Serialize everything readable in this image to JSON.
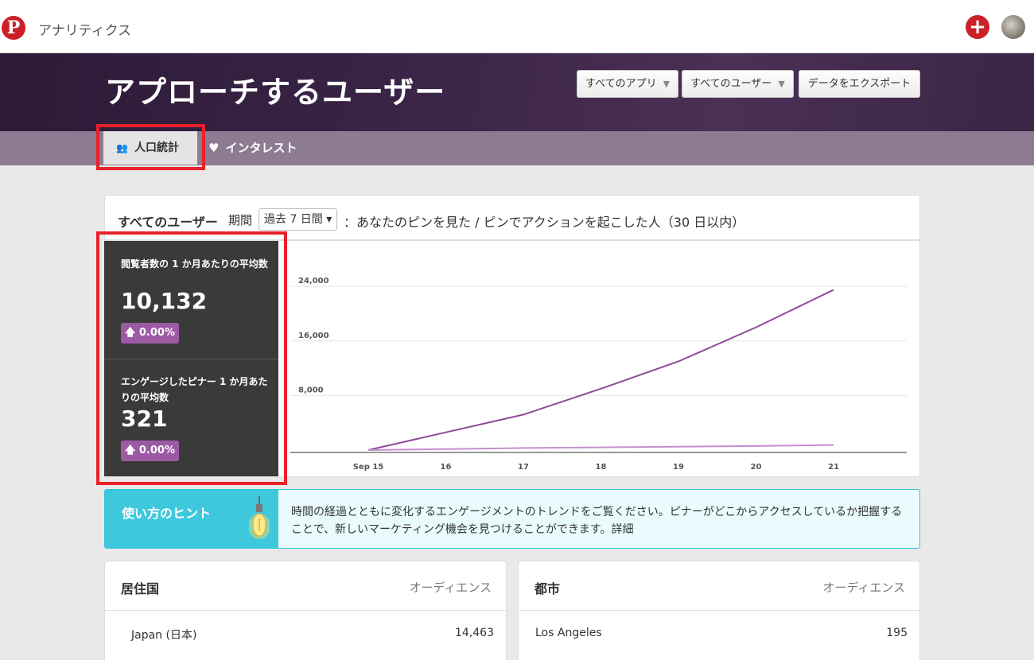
{
  "topbar": {
    "logo": "P",
    "title": "アナリティクス",
    "plus": "+"
  },
  "hero": {
    "title": "アプローチするユーザー",
    "buttons": [
      {
        "label": "すべてのアプリ"
      },
      {
        "label": "すべてのユーザー"
      },
      {
        "label": "データをエクスポート"
      }
    ],
    "caret": "▼"
  },
  "tabs": [
    {
      "label": "人口統計",
      "icon": "users-icon",
      "active": true
    },
    {
      "label": "インタレスト",
      "icon": "heart-icon",
      "active": false
    }
  ],
  "card": {
    "title": "すべてのユーザー",
    "period_label": "期間",
    "period_value": "過去 7 日間 ▾",
    "description": "：あなたのピンを見た / ピンでアクションを起こした人（30 日以内）"
  },
  "stats": [
    {
      "label": "閲覧者数の 1 か月あたりの平均数",
      "value": "10,132",
      "change": "0.00%"
    },
    {
      "label": "エンゲージしたピナー 1 か月あたりの平均数",
      "value": "321",
      "change": "0.00%"
    }
  ],
  "chart_data": {
    "type": "line",
    "categories": [
      "Sep 15",
      "16",
      "17",
      "18",
      "19",
      "20",
      "21"
    ],
    "y_ticks": [
      "24,000",
      "16,000",
      "8,000"
    ],
    "ylim": [
      0,
      26000
    ],
    "grid": true,
    "series": [
      {
        "values": [
          0,
          2600,
          5200,
          9000,
          13000,
          18000,
          23500
        ],
        "color": "#8e4a97"
      },
      {
        "values": [
          0,
          150,
          300,
          400,
          500,
          600,
          750
        ],
        "color": "#c58fcf"
      }
    ]
  },
  "tip": {
    "title": "使い方のヒント",
    "text": "時間の経過とともに変化するエンゲージメントのトレンドをご覧ください。ピナーがどこからアクセスしているか把握することで、新しいマーケティング機会を見つけることができます。詳細"
  },
  "tables": [
    {
      "title": "居住国",
      "col": "オーディエンス",
      "row_name": "Japan (日本)",
      "row_value": "14,463"
    },
    {
      "title": "都市",
      "col": "オーディエンス",
      "row_name": "Los Angeles",
      "row_value": "195"
    }
  ],
  "colors": {
    "accent": "#cb2027",
    "purple": "#9c5aa5",
    "tip": "#3ec8dd",
    "highlight": "#e8212b"
  }
}
